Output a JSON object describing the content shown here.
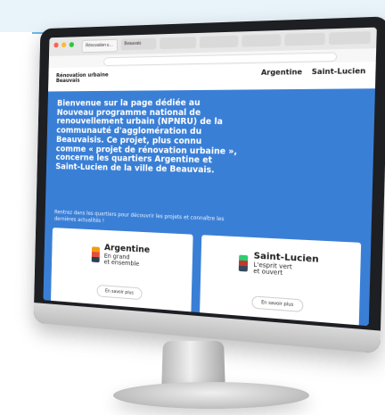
{
  "browser": {
    "tabs": [
      "Rénovation urbaine",
      "Beauvais",
      "",
      "",
      "",
      "",
      ""
    ],
    "active_tab_index": 0
  },
  "site": {
    "logo_line1": "Rénovation urbaine",
    "logo_line2": "Beauvais",
    "header_links": [
      "Argentine",
      "Saint-Lucien"
    ]
  },
  "hero": {
    "text": "Bienvenue sur la page dédiée au Nouveau programme national de renouvellement urbain (NPNRU) de la communauté d'agglomération du Beauvaisis. Ce projet, plus connu comme « projet de rénovation urbaine », concerne les quartiers Argentine et Saint-Lucien de la ville de Beauvais.",
    "subtitle": "Rentrez dans les quartiers pour découvrir les projets et connaître les dernières actualités !"
  },
  "cards": [
    {
      "name": "Argentine",
      "tagline_line1": "En grand",
      "tagline_line2": "et ensemble",
      "button": "En savoir plus",
      "flag_colors": [
        "#f39c12",
        "#e74c3c",
        "#2c3e50"
      ]
    },
    {
      "name": "Saint-Lucien",
      "tagline_line1": "L'esprit vert",
      "tagline_line2": "et ouvert",
      "button": "En savoir plus",
      "flag_colors": [
        "#2ecc71",
        "#c0392b",
        "#34495e"
      ]
    }
  ],
  "colors": {
    "content_blue": "#3a7fd6",
    "top_band": "#e9f3fa"
  }
}
